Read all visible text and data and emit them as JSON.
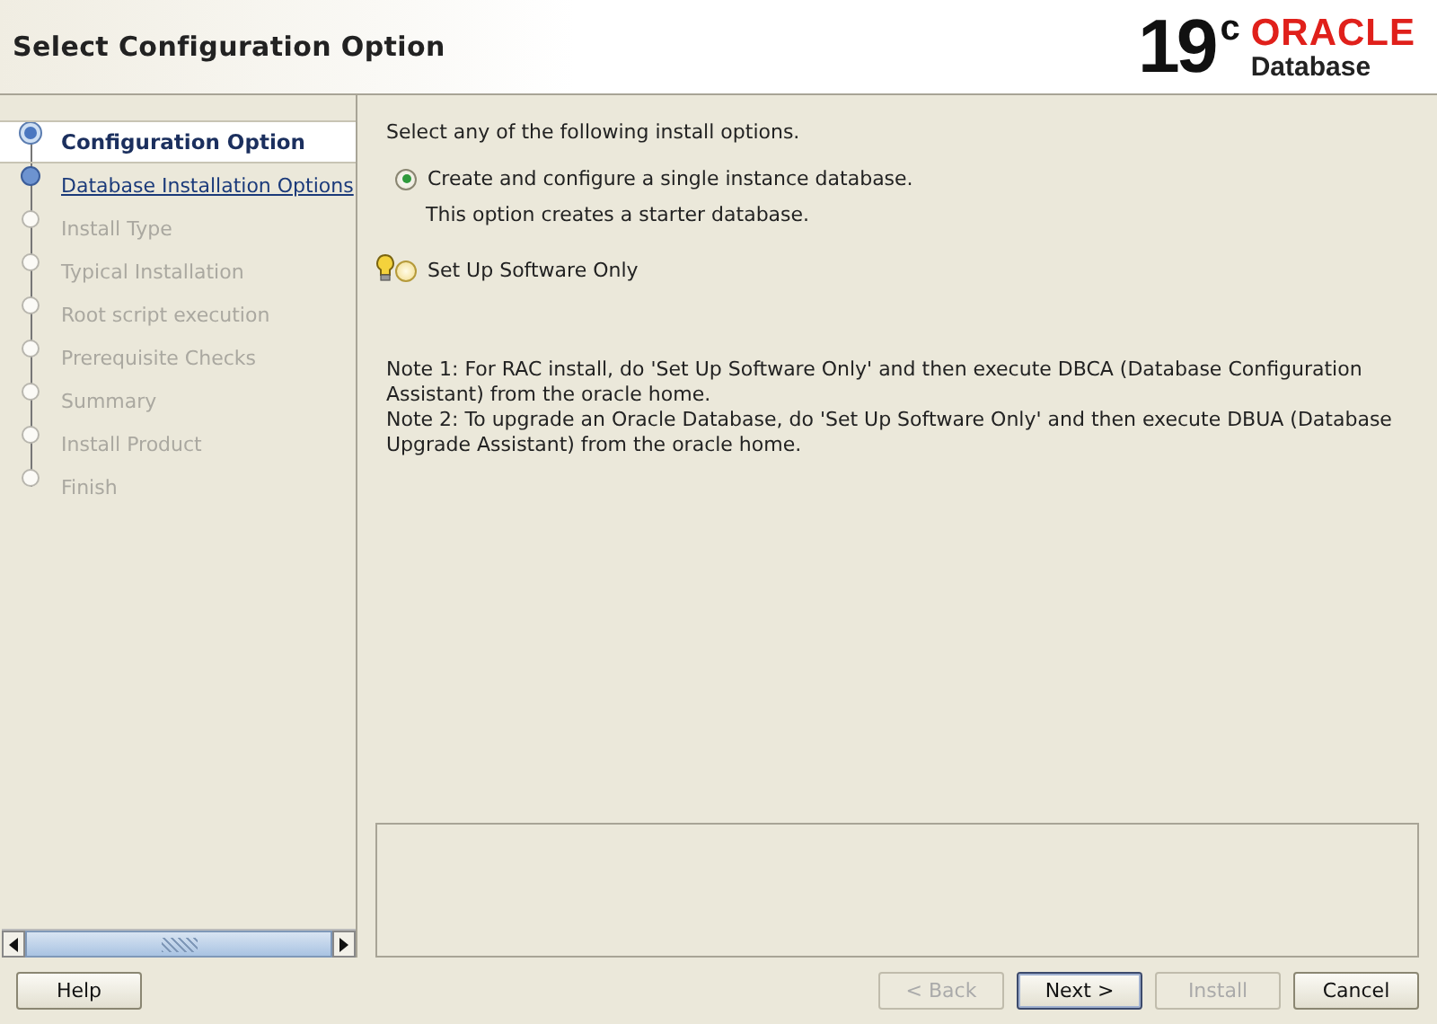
{
  "header": {
    "title": "Select Configuration Option",
    "version": "19",
    "version_sup": "c",
    "brand": "ORACLE",
    "product": "Database"
  },
  "steps": [
    {
      "label": "Configuration Option",
      "kind": "current",
      "selected": true
    },
    {
      "label": "Database Installation Options",
      "kind": "link",
      "selected": false
    },
    {
      "label": "Install Type",
      "kind": "pending",
      "selected": false
    },
    {
      "label": "Typical Installation",
      "kind": "pending",
      "selected": false
    },
    {
      "label": "Root script execution",
      "kind": "pending",
      "selected": false
    },
    {
      "label": "Prerequisite Checks",
      "kind": "pending",
      "selected": false
    },
    {
      "label": "Summary",
      "kind": "pending",
      "selected": false
    },
    {
      "label": "Install Product",
      "kind": "pending",
      "selected": false
    },
    {
      "label": "Finish",
      "kind": "pending",
      "selected": false
    }
  ],
  "content": {
    "intro": "Select any of the following install options.",
    "options": [
      {
        "label": "Create and configure a single instance database.",
        "description": "This option creates a starter database.",
        "selected": true,
        "hint": false
      },
      {
        "label": "Set Up Software Only",
        "selected": false,
        "hint": true
      }
    ],
    "notes": [
      "Note 1: For RAC install, do 'Set Up Software Only' and then execute DBCA (Database Configuration Assistant) from the oracle home.",
      "Note 2: To upgrade an Oracle Database, do 'Set Up Software Only' and then execute DBUA (Database Upgrade Assistant) from the oracle home."
    ]
  },
  "buttons": [
    {
      "label": "Help",
      "disabled": false,
      "default": false
    },
    {
      "label": "< Back",
      "disabled": true,
      "default": false
    },
    {
      "label": "Next >",
      "disabled": false,
      "default": true
    },
    {
      "label": "Install",
      "disabled": true,
      "default": false
    },
    {
      "label": "Cancel",
      "disabled": false,
      "default": false
    }
  ]
}
